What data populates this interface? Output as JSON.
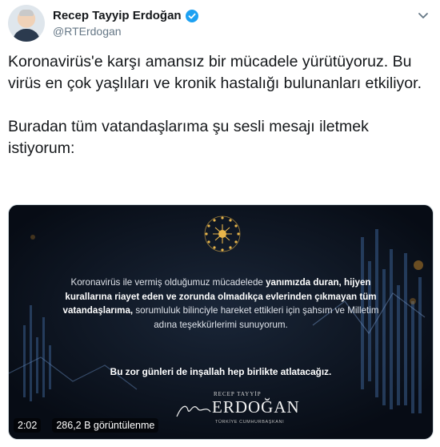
{
  "author": {
    "name": "Recep Tayyip Erdoğan",
    "handle": "@RTErdogan",
    "verified": true
  },
  "tweet": {
    "paragraphs": [
      "Koronavirüs'e karşı amansız bir mücadele yürütüyoruz. Bu virüs en çok yaşlıları ve kronik hastalığı bulunanları etkiliyor.",
      "Buradan tüm vatandaşlarıma şu sesli mesajı iletmek istiyorum:"
    ]
  },
  "media": {
    "message_parts": [
      {
        "text": "Koronavirüs ile vermiş olduğumuz mücadelede ",
        "bold": false
      },
      {
        "text": "yanımızda duran, hijyen kurallarına riayet eden ve zorunda olmadıkça evlerinden çıkmayan tüm vatandaşlarıma,",
        "bold": true
      },
      {
        "text": " sorumluluk bilinciyle hareket ettikleri için şahsım ve Milletim adına teşekkürlerimi sunuyorum.",
        "bold": false
      }
    ],
    "closing": "Bu zor günleri de inşallah hep birlikte atlatacağız.",
    "signature_top": "RECEP TAYYİP",
    "signature_name": "ERDOĞAN",
    "signature_sub": "TÜRKİYE CUMHURBAŞKANI",
    "duration": "2:02",
    "views": "286,2 B görüntülenme"
  },
  "colors": {
    "verified": "#1da1f2",
    "handle": "#657786",
    "media_bg": "#0b1320",
    "emblem_gold": "#e8b54a"
  },
  "icons": {
    "verified": "verified-badge-icon",
    "more": "chevron-down-icon"
  }
}
